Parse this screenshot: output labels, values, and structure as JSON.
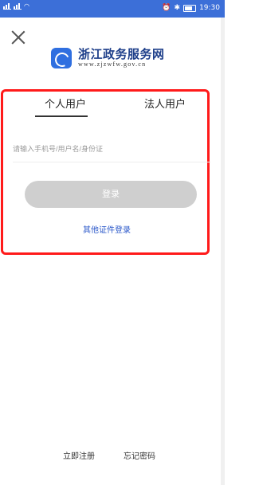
{
  "status_bar": {
    "left_text": "",
    "time": "19:30"
  },
  "header": {
    "brand_title": "浙江政务服务网",
    "brand_url": "www.zjzwfw.gov.cn"
  },
  "tabs": [
    {
      "label": "个人用户",
      "selected": true
    },
    {
      "label": "法人用户",
      "selected": false
    }
  ],
  "form": {
    "input_value": "",
    "input_placeholder": "请输入手机号/用户名/身份证",
    "login_label": "登录",
    "other_login_label": "其他证件登录"
  },
  "footer": {
    "register_label": "立即注册",
    "forgot_label": "忘记密码"
  },
  "colors": {
    "status_bar": "#3c6fd8",
    "frame": "#ff1a1a",
    "link": "#2a57c9",
    "login_btn": "#cfcfcf"
  }
}
